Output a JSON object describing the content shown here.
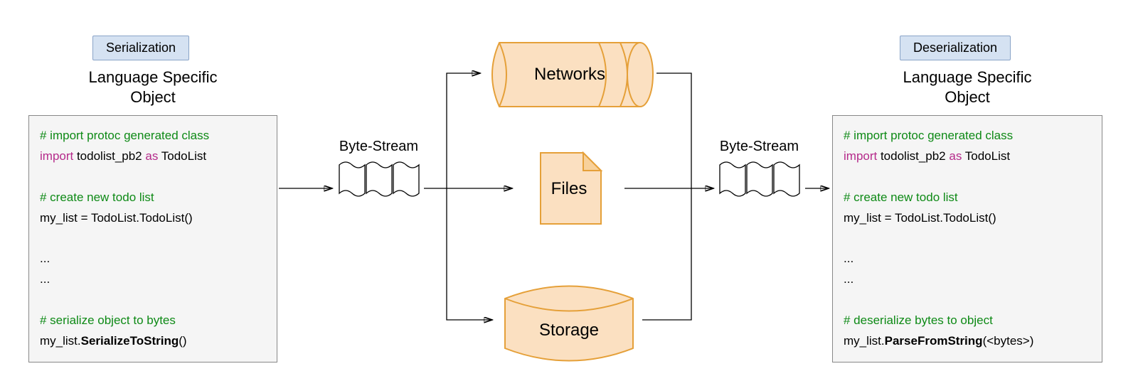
{
  "left": {
    "badge": "Serialization",
    "title_line1": "Language Specific",
    "title_line2": "Object",
    "code": {
      "comment1": "# import protoc generated class",
      "import_kw1": "import",
      "import_mod": " todolist_pb2 ",
      "import_kw2": "as",
      "import_alias": " TodoList",
      "comment2": "# create new todo list",
      "line2": "my_list = TodoList.TodoList()",
      "dots1": "...",
      "dots2": "...",
      "comment3": "# serialize object to bytes",
      "call_obj": "my_list.",
      "call_method": "SerializeToString",
      "call_tail": "()"
    }
  },
  "right": {
    "badge": "Deserialization",
    "title_line1": "Language Specific",
    "title_line2": "Object",
    "code": {
      "comment1": "# import protoc generated class",
      "import_kw1": "import",
      "import_mod": " todolist_pb2 ",
      "import_kw2": "as",
      "import_alias": " TodoList",
      "comment2": "# create new todo list",
      "line2": "my_list = TodoList.TodoList()",
      "dots1": "...",
      "dots2": "...",
      "comment3": "# deserialize bytes to object",
      "call_obj": "my_list.",
      "call_method": "ParseFromString",
      "call_tail": "(<bytes>)"
    }
  },
  "bytestream": {
    "label": "Byte-Stream"
  },
  "middle": {
    "networks": "Networks",
    "files": "Files",
    "storage": "Storage"
  },
  "colors": {
    "shape_fill": "#fbe0c1",
    "shape_stroke": "#e5a039"
  }
}
